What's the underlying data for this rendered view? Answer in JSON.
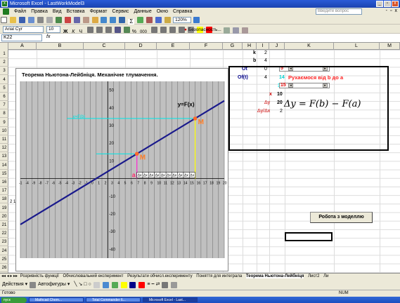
{
  "window": {
    "title": "Microsoft Excel - LastWorkModel3",
    "minimize": "_",
    "maximize": "▫",
    "close": "x",
    "doc_minimize": "-",
    "doc_restore": "▫",
    "doc_close": "x"
  },
  "menu": [
    "Файл",
    "Правка",
    "Вид",
    "Вставка",
    "Формат",
    "Сервис",
    "Данные",
    "Окно",
    "Справка"
  ],
  "question_placeholder": "Введите вопрос",
  "toolbar": {
    "font": "Arial Cyr",
    "size": "10",
    "zoom": "120%",
    "bold": "Ж",
    "italic": "К",
    "underline": "Ч",
    "percent": "%",
    "thousands": "000",
    "security": "Безопасность..."
  },
  "formula_bar": {
    "namebox": "K22",
    "fx": "fx",
    "value": ""
  },
  "columns": [
    "A",
    "B",
    "C",
    "D",
    "E",
    "F",
    "G",
    "H",
    "I",
    "J",
    "K",
    "L",
    "M"
  ],
  "rows": [
    "1",
    "2",
    "3",
    "4",
    "5",
    "6",
    "7",
    "8",
    "9",
    "10",
    "11",
    "12",
    "13",
    "14",
    "15",
    "16",
    "17",
    "18",
    "19",
    "20",
    "21",
    "22",
    "23",
    "24",
    "25",
    "26"
  ],
  "cells": {
    "k_label": "k",
    "k_value": "2",
    "b_label": "b",
    "b_value": "4",
    "ot_label": "Ot",
    "ot_value": "0",
    "ot_spin": "5",
    "oft_label": "Of(t)",
    "oft_value": "4",
    "oft_spin": "14",
    "oft_text": "Рухаємося від b до a",
    "j6_spin": "15",
    "j7_value": "34",
    "x_label": "x",
    "x_value": "10",
    "dy_label": "Δy",
    "dy_value": "20",
    "dydx_label": "Δy/Δx",
    "dydx_value": "2",
    "formula": "Δy = F(b) − F(a)",
    "row17_extra": "2 1 0"
  },
  "chart_data": {
    "type": "line",
    "title": "Теорема Ньютона-Лейбніця. Механічне тлумачення.",
    "series": [
      {
        "name": "y=F(x)",
        "x": [
          -15,
          20
        ],
        "y": [
          -26,
          44
        ]
      }
    ],
    "x_ticks": [
      "-1",
      "-4",
      "-9",
      "-8",
      "-7",
      "-6",
      "-5",
      "-4",
      "-3",
      "-2",
      "-1",
      "0",
      "1",
      "2",
      "3",
      "4",
      "5",
      "6",
      "7",
      "8",
      "9",
      "10",
      "11",
      "12",
      "13",
      "14",
      "15",
      "16",
      "17",
      "18",
      "19",
      "20"
    ],
    "y_ticks": [
      "50",
      "40",
      "30",
      "20",
      "10",
      "-10",
      "-20",
      "-30",
      "-40"
    ],
    "xlim": [
      -15,
      20
    ],
    "ylim": [
      -45,
      55
    ],
    "points": [
      {
        "label": "M",
        "x": 5,
        "y": 14
      },
      {
        "label": "M",
        "x": 15,
        "y": 34
      }
    ],
    "a_label": "a",
    "b_label": "b",
    "f_label": "y=F(x)",
    "cyan_level_text": "y=F(b)",
    "dx_marks": "Δx",
    "colors": {
      "line": "#1a1a8c",
      "cyan": "#00e5e5",
      "point": "#ff6a2a",
      "marker_text": "#ff7f2a",
      "grid": "#808080"
    }
  },
  "button": {
    "label": "Робота з моделлю"
  },
  "sheets": [
    "Розривність функції",
    "Обчислювальний експеримент",
    "Результати обчисл.експерименту",
    "Поняття для интеграла",
    "Теорема Ньютона-Лейбніця",
    "Лист2",
    "Ли"
  ],
  "drawbar": {
    "actions": "Действия ▾",
    "autoshapes": "Автофигуры ▾"
  },
  "status": {
    "left": "Готово",
    "right": "NUM"
  },
  "taskbar": [
    "пуск",
    "Mathcad Chem...",
    "Total Commander 6...",
    "Microsoft Excel - Last..."
  ]
}
